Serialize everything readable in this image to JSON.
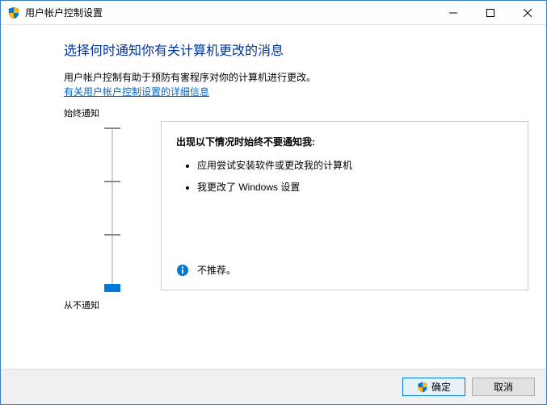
{
  "window": {
    "title": "用户帐户控制设置"
  },
  "heading": "选择何时通知你有关计算机更改的消息",
  "description": "用户帐户控制有助于预防有害程序对你的计算机进行更改。",
  "link_text": "有关用户帐户控制设置的详细信息",
  "slider": {
    "top_label": "始终通知",
    "bottom_label": "从不通知",
    "levels": 4,
    "value_index": 3
  },
  "panel": {
    "heading": "出现以下情况时始终不要通知我:",
    "items": [
      "应用尝试安装软件或更改我的计算机",
      "我更改了 Windows 设置"
    ],
    "recommendation": "不推荐。"
  },
  "footer": {
    "ok_label": "确定",
    "cancel_label": "取消"
  }
}
